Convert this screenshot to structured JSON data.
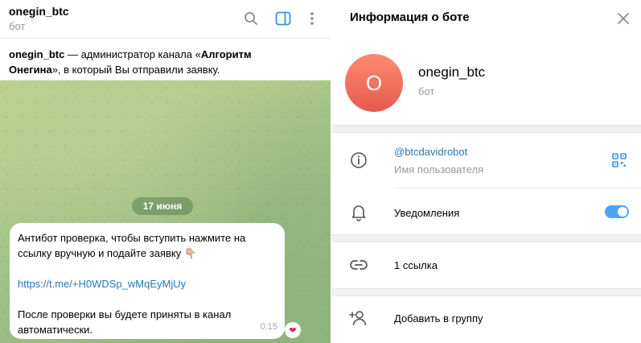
{
  "chat": {
    "title": "onegin_btc",
    "subtitle": "бот",
    "notice": {
      "bold_name": "onegin_btc",
      "text_middle": " — администратор канала «",
      "bold_channel_1": "Алгоритм",
      "bold_channel_2": "Онегина",
      "text_end": "», в который Вы отправили заявку."
    },
    "date_label": "17 июня",
    "message": {
      "line1": "Антибот проверка, чтобы вступить нажмите  на",
      "line2": "ссылку вручную и подайте заявку 👇🏼",
      "link": "https://t.me/+H0WDSp_wMqEyMjUy",
      "line4": "После проверки вы будете приняты в канал",
      "line5": "автоматически.",
      "time": "0:15",
      "reaction": "❤"
    }
  },
  "info": {
    "title": "Информация о боте",
    "profile": {
      "avatar_letter": "O",
      "name": "onegin_btc",
      "subtitle": "бот"
    },
    "username": {
      "value": "@btcdavidrobot",
      "label": "Имя пользователя"
    },
    "notifications_label": "Уведомления",
    "notifications_enabled": true,
    "links_label": "1 ссылка",
    "add_to_group_label": "Добавить в группу"
  },
  "colors": {
    "accent": "#2678b6",
    "toggle": "#4ea4f6",
    "avatar": "#e35b4f"
  }
}
